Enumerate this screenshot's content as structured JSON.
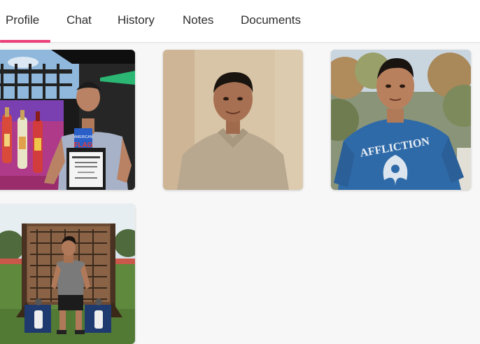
{
  "tabs": [
    {
      "label": "Profile",
      "active": true
    },
    {
      "label": "Chat",
      "active": false
    },
    {
      "label": "History",
      "active": false
    },
    {
      "label": "Notes",
      "active": false
    },
    {
      "label": "Documents",
      "active": false
    }
  ],
  "accent_color": "#ec407a",
  "photos": [
    {
      "name": "photo-award-banner",
      "flag_text": "FLAG",
      "brand_text": "AMERICAN"
    },
    {
      "name": "photo-portrait-polo"
    },
    {
      "name": "photo-outdoor-tee",
      "shirt_text": "AFFLICTION"
    },
    {
      "name": "photo-obstacle-course"
    }
  ]
}
